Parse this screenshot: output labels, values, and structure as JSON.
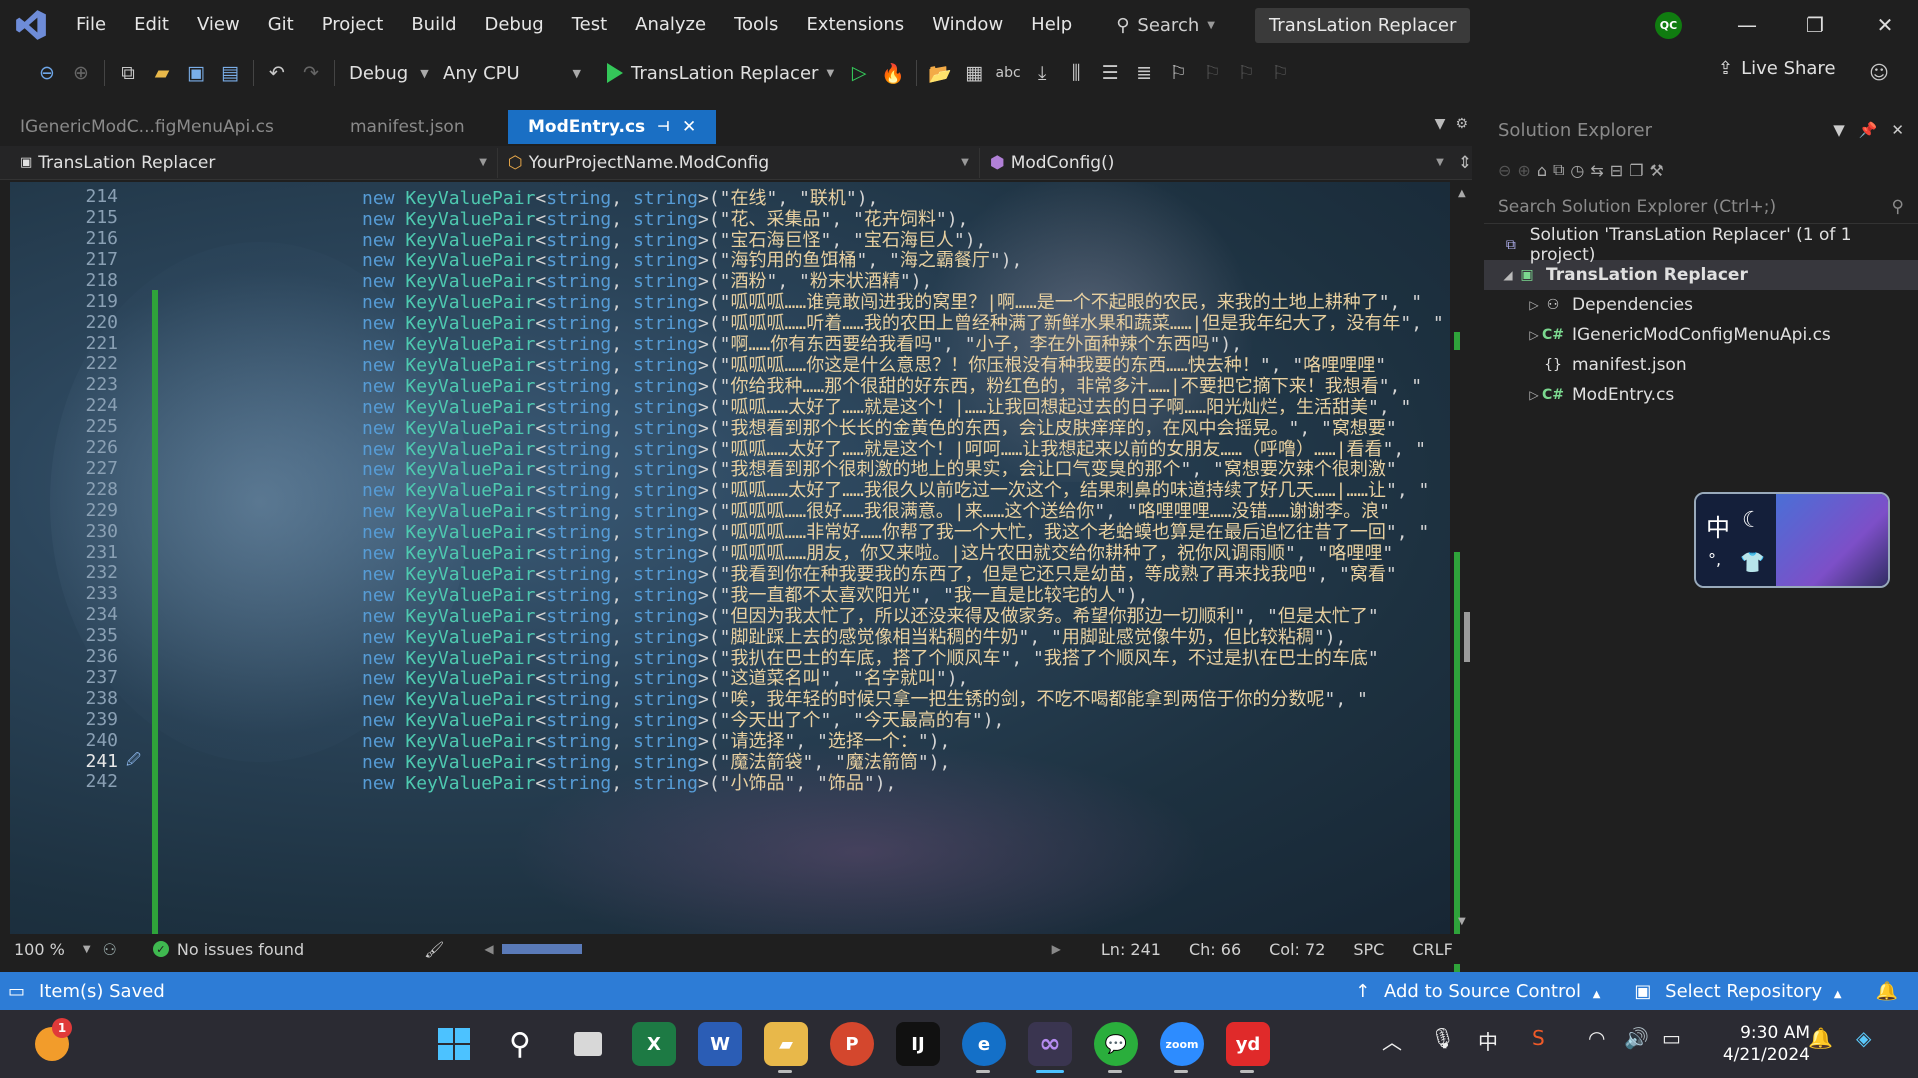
{
  "menu": {
    "items": [
      "File",
      "Edit",
      "View",
      "Git",
      "Project",
      "Build",
      "Debug",
      "Test",
      "Analyze",
      "Tools",
      "Extensions",
      "Window",
      "Help"
    ],
    "search_label": "Search",
    "solution_title": "TransLation Replacer",
    "avatar_initials": "QC"
  },
  "toolbar": {
    "config": "Debug",
    "platform": "Any CPU",
    "run_target": "TransLation Replacer",
    "live_share": "Live Share"
  },
  "tabs": [
    {
      "label": "IGenericModC...figMenuApi.cs"
    },
    {
      "label": "manifest.json"
    },
    {
      "label": "ModEntry.cs"
    }
  ],
  "navbar": {
    "project": "TransLation Replacer",
    "class": "YourProjectName.ModConfig",
    "member": "ModConfig()"
  },
  "editor": {
    "accent": "#2fa33a",
    "current_line": 241,
    "lines": [
      {
        "n": "214",
        "a": "在线",
        "b": "联机",
        "tail": "),"
      },
      {
        "n": "215",
        "a": "花、采集品",
        "b": "花卉饲料",
        "tail": "),"
      },
      {
        "n": "216",
        "a": "宝石海巨怪",
        "b": "宝石海巨人",
        "tail": "),"
      },
      {
        "n": "217",
        "a": "海钓用的鱼饵桶",
        "b": "海之霸餐厅",
        "tail": "),"
      },
      {
        "n": "218",
        "a": "酒粉",
        "b": "粉末状酒精",
        "tail": "),"
      },
      {
        "n": "219",
        "a": "呱呱呱……谁竟敢闯进我的窝里？|啊……是一个不起眼的农民，来我的土地上耕种了",
        "b": "",
        "tail": ""
      },
      {
        "n": "220",
        "a": "呱呱呱……听着……我的农田上曾经种满了新鲜水果和蔬菜……|但是我年纪大了，没有年",
        "b": "",
        "tail": ""
      },
      {
        "n": "221",
        "a": "啊……你有东西要给我看吗",
        "b": "小子，李在外面种辣个东西吗",
        "tail": "),"
      },
      {
        "n": "222",
        "a": "呱呱呱……你这是什么意思？！你压根没有种我要的东西……快去种！",
        "b": "咯哩哩哩",
        "tail": ""
      },
      {
        "n": "223",
        "a": "你给我种……那个很甜的好东西，粉红色的，非常多汁……|不要把它摘下来！我想看",
        "b": "",
        "tail": ""
      },
      {
        "n": "224",
        "a": "呱呱……太好了……就是这个！|……让我回想起过去的日子啊……阳光灿烂，生活甜美",
        "b": "",
        "tail": ""
      },
      {
        "n": "225",
        "a": "我想看到那个长长的金黄色的东西，会让皮肤痒痒的，在风中会摇晃。",
        "b": "窝想要",
        "tail": ""
      },
      {
        "n": "226",
        "a": "呱呱……太好了……就是这个！|呵呵……让我想起来以前的女朋友……（呼噜）……|看看",
        "b": "",
        "tail": ""
      },
      {
        "n": "227",
        "a": "我想看到那个很刺激的地上的果实，会让口气变臭的那个",
        "b": "窝想要次辣个很刺激",
        "tail": ""
      },
      {
        "n": "228",
        "a": "呱呱……太好了……我很久以前吃过一次这个，结果刺鼻的味道持续了好几天……|……让",
        "b": "",
        "tail": ""
      },
      {
        "n": "229",
        "a": "呱呱呱……很好……我很满意。|来……这个送给你",
        "b": "咯哩哩哩……没错……谢谢李。浪",
        "tail": ""
      },
      {
        "n": "230",
        "a": "呱呱呱……非常好……你帮了我一个大忙，我这个老蛤蟆也算是在最后追忆往昔了一回",
        "b": "",
        "tail": ""
      },
      {
        "n": "231",
        "a": "呱呱呱……朋友，你又来啦。|这片农田就交给你耕种了，祝你风调雨顺",
        "b": "咯哩哩",
        "tail": ""
      },
      {
        "n": "232",
        "a": "我看到你在种我要我的东西了，但是它还只是幼苗，等成熟了再来找我吧",
        "b": "窝看",
        "tail": ""
      },
      {
        "n": "233",
        "a": "我一直都不太喜欢阳光",
        "b": "我一直是比较宅的人",
        "tail": "),"
      },
      {
        "n": "234",
        "a": "但因为我太忙了，所以还没来得及做家务。希望你那边一切顺利",
        "b": "但是太忙了",
        "tail": ""
      },
      {
        "n": "235",
        "a": "脚趾踩上去的感觉像相当粘稠的牛奶",
        "b": "用脚趾感觉像牛奶，但比较粘稠",
        "tail": "),"
      },
      {
        "n": "236",
        "a": "我扒在巴士的车底，搭了个顺风车",
        "b": "我搭了个顺风车，不过是扒在巴士的车底",
        "tail": ""
      },
      {
        "n": "237",
        "a": "这道菜名叫",
        "b": "名字就叫",
        "tail": "),"
      },
      {
        "n": "238",
        "a": "唉，我年轻的时候只拿一把生锈的剑，不吃不喝都能拿到两倍于你的分数呢",
        "b": "",
        "tail": ""
      },
      {
        "n": "239",
        "a": "今天出了个",
        "b": "今天最高的有",
        "tail": "),"
      },
      {
        "n": "240",
        "a": "请选择",
        "b": "选择一个：",
        "tail": "),"
      },
      {
        "n": "241",
        "a": "魔法箭袋",
        "b": "魔法箭筒",
        "tail": "),"
      },
      {
        "n": "242",
        "a": "小饰品",
        "b": "饰品",
        "tail": "),"
      }
    ],
    "kw_new": "new",
    "type_name": "KeyValuePair",
    "kw_string": "string"
  },
  "edstatus": {
    "zoom": "100 %",
    "issues": "No issues found",
    "ln": "Ln: 241",
    "ch": "Ch: 66",
    "col": "Col: 72",
    "spc": "SPC",
    "crlf": "CRLF"
  },
  "solution_explorer": {
    "title": "Solution Explorer",
    "search_placeholder": "Search Solution Explorer (Ctrl+;)",
    "solution": "Solution 'TransLation Replacer' (1 of 1 project)",
    "project": "TransLation Replacer",
    "items": [
      "Dependencies",
      "IGenericModConfigMenuApi.cs",
      "manifest.json",
      "ModEntry.cs"
    ]
  },
  "ime": {
    "char": "中"
  },
  "statusbar": {
    "saved": "Item(s) Saved",
    "source_control": "Add to Source Control",
    "repository": "Select Repository"
  },
  "taskbar": {
    "time": "9:30 AM",
    "date": "4/21/2024",
    "badge": "1",
    "ime_char": "中"
  }
}
